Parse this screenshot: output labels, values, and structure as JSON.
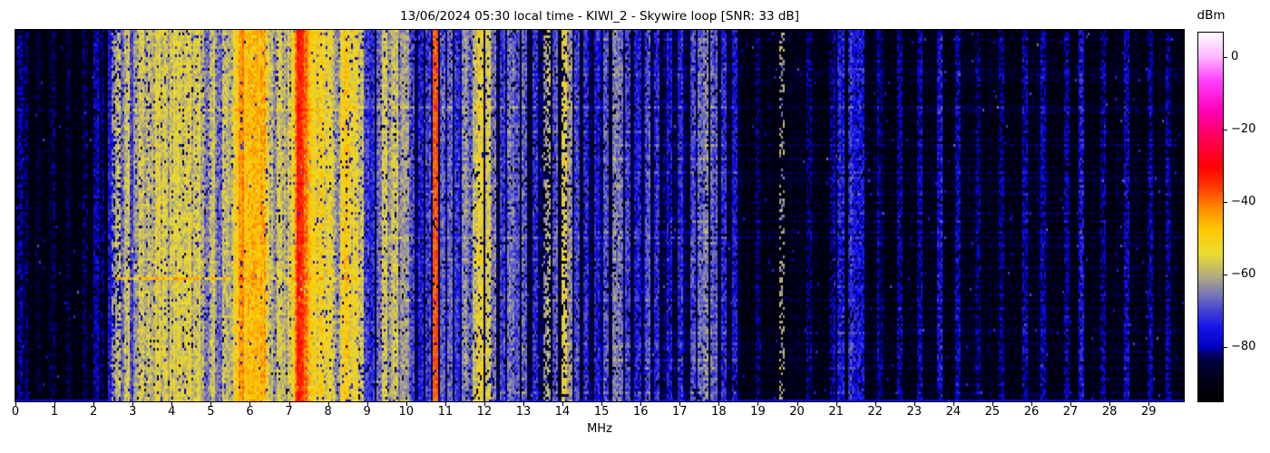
{
  "figure": {
    "title": "13/06/2024 05:30 local time - KIWI_2 - Skywire loop [SNR: 33 dB]",
    "xlabel": "MHz",
    "colorbar_label": "dBm"
  },
  "chart_data": {
    "type": "heatmap",
    "subtype": "radio-spectrogram-waterfall",
    "title": "13/06/2024 05:30 local time - KIWI_2 - Skywire loop [SNR: 33 dB]",
    "xlabel": "MHz",
    "snr_db": 33,
    "x_range_mhz": [
      0,
      29.9
    ],
    "x_ticks": [
      0,
      1,
      2,
      3,
      4,
      5,
      6,
      7,
      8,
      9,
      10,
      11,
      12,
      13,
      14,
      15,
      16,
      17,
      18,
      19,
      20,
      21,
      22,
      23,
      24,
      25,
      26,
      27,
      28,
      29
    ],
    "level_range_dbm": [
      -94.5,
      7
    ],
    "colorbar": {
      "label": "dBm",
      "ticks": [
        {
          "dbm": 0,
          "label": "0"
        },
        {
          "dbm": -20,
          "label": "−20"
        },
        {
          "dbm": -40,
          "label": "−40"
        },
        {
          "dbm": -60,
          "label": "−60"
        },
        {
          "dbm": -80,
          "label": "−80"
        }
      ]
    },
    "colormap_stops": [
      [
        0.0,
        "#000000"
      ],
      [
        0.06,
        "#000018"
      ],
      [
        0.105,
        "#000038"
      ],
      [
        0.125,
        "#000060"
      ],
      [
        0.148,
        "#0000c0"
      ],
      [
        0.2,
        "#1414e8"
      ],
      [
        0.24,
        "#3c3cd8"
      ],
      [
        0.29,
        "#7878b8"
      ],
      [
        0.34,
        "#b4aa7e"
      ],
      [
        0.4,
        "#e8dc32"
      ],
      [
        0.465,
        "#ffc800"
      ],
      [
        0.53,
        "#ff8200"
      ],
      [
        0.58,
        "#ff3c00"
      ],
      [
        0.635,
        "#ff0000"
      ],
      [
        0.71,
        "#ff0050"
      ],
      [
        0.79,
        "#ff00b8"
      ],
      [
        0.87,
        "#ff40ff"
      ],
      [
        0.935,
        "#ffb8ff"
      ],
      [
        1.0,
        "#ffffff"
      ]
    ],
    "regions_format": "from/to in MHz, floor = mean noise floor dBm, streak = vertical striping amplitude dB",
    "regions": [
      {
        "from": 0.0,
        "to": 0.35,
        "floor": -89.0,
        "streak": 2.0
      },
      {
        "from": 0.35,
        "to": 2.35,
        "floor": -90.5,
        "streak": 1.5
      },
      {
        "from": 2.35,
        "to": 3.5,
        "floor": -81.0,
        "streak": 4.0
      },
      {
        "from": 3.5,
        "to": 4.5,
        "floor": -78.0,
        "streak": 5.0
      },
      {
        "from": 4.5,
        "to": 5.55,
        "floor": -80.0,
        "streak": 5.0
      },
      {
        "from": 5.55,
        "to": 6.45,
        "floor": -75.0,
        "streak": 6.0
      },
      {
        "from": 6.45,
        "to": 7.05,
        "floor": -78.0,
        "streak": 5.0
      },
      {
        "from": 7.05,
        "to": 7.65,
        "floor": -68.0,
        "streak": 6.0
      },
      {
        "from": 7.65,
        "to": 8.85,
        "floor": -76.0,
        "streak": 6.0
      },
      {
        "from": 8.85,
        "to": 9.95,
        "floor": -83.0,
        "streak": 4.0
      },
      {
        "from": 9.95,
        "to": 12.3,
        "floor": -84.5,
        "streak": 3.5
      },
      {
        "from": 12.3,
        "to": 18.6,
        "floor": -86.0,
        "streak": 3.0
      },
      {
        "from": 18.6,
        "to": 29.9,
        "floor": -90.0,
        "streak": 1.5
      }
    ],
    "carriers_format": "f = center MHz, l = level dBm, w = width MHz (default 0.05), fl = flicker dB, d = duty cycle 0..1",
    "carriers": [
      {
        "f": 0.08,
        "l": -82
      },
      {
        "f": 0.25,
        "l": -84
      },
      {
        "f": 0.55,
        "l": -86
      },
      {
        "f": 0.95,
        "l": -84
      },
      {
        "f": 1.35,
        "l": -86
      },
      {
        "f": 1.75,
        "l": -84
      },
      {
        "f": 2.05,
        "l": -79
      },
      {
        "f": 2.18,
        "l": -82
      },
      {
        "f": 2.42,
        "l": -74
      },
      {
        "f": 2.5,
        "l": -62,
        "d": 0.6
      },
      {
        "f": 2.62,
        "l": -58,
        "d": 0.75
      },
      {
        "f": 2.72,
        "l": -66
      },
      {
        "f": 2.85,
        "l": -57
      },
      {
        "f": 2.95,
        "l": -70
      },
      {
        "f": 3.07,
        "l": -62
      },
      {
        "f": 3.2,
        "l": -56
      },
      {
        "f": 3.3,
        "l": -60
      },
      {
        "f": 3.42,
        "l": -58
      },
      {
        "f": 3.55,
        "l": -60
      },
      {
        "f": 3.64,
        "l": -55
      },
      {
        "f": 3.73,
        "l": -58
      },
      {
        "f": 3.82,
        "l": -55
      },
      {
        "f": 3.9,
        "l": -60
      },
      {
        "f": 3.98,
        "l": -56
      },
      {
        "f": 4.07,
        "l": -58
      },
      {
        "f": 4.17,
        "l": -55
      },
      {
        "f": 4.28,
        "l": -58
      },
      {
        "f": 4.4,
        "l": -55
      },
      {
        "f": 4.52,
        "l": -62
      },
      {
        "f": 4.62,
        "l": -57
      },
      {
        "f": 4.75,
        "l": -60
      },
      {
        "f": 4.88,
        "l": -64
      },
      {
        "f": 5.0,
        "l": -57
      },
      {
        "f": 5.08,
        "l": -62
      },
      {
        "f": 5.2,
        "l": -66
      },
      {
        "f": 5.32,
        "l": -57
      },
      {
        "f": 5.42,
        "l": -62
      },
      {
        "f": 5.5,
        "l": -60
      },
      {
        "f": 5.6,
        "l": -54
      },
      {
        "f": 5.68,
        "l": -50
      },
      {
        "f": 5.75,
        "l": -42,
        "w": 0.06,
        "fl": 4,
        "d": 0.95
      },
      {
        "f": 5.83,
        "l": -52
      },
      {
        "f": 5.9,
        "l": -47
      },
      {
        "f": 5.97,
        "l": -52
      },
      {
        "f": 6.05,
        "l": -45
      },
      {
        "f": 6.12,
        "l": -50
      },
      {
        "f": 6.18,
        "l": -47
      },
      {
        "f": 6.25,
        "l": -52
      },
      {
        "f": 6.31,
        "l": -44
      },
      {
        "f": 6.4,
        "l": -54
      },
      {
        "f": 6.5,
        "l": -58
      },
      {
        "f": 6.6,
        "l": -64
      },
      {
        "f": 6.72,
        "l": -57
      },
      {
        "f": 6.82,
        "l": -60
      },
      {
        "f": 6.92,
        "l": -62
      },
      {
        "f": 7.0,
        "l": -56
      },
      {
        "f": 7.1,
        "l": -50
      },
      {
        "f": 7.18,
        "l": -42
      },
      {
        "f": 7.27,
        "l": -33,
        "w": 0.1,
        "fl": 4,
        "d": 0.97
      },
      {
        "f": 7.38,
        "l": -40
      },
      {
        "f": 7.45,
        "l": -46
      },
      {
        "f": 7.55,
        "l": -50
      },
      {
        "f": 7.62,
        "l": -53
      },
      {
        "f": 7.72,
        "l": -54
      },
      {
        "f": 7.82,
        "l": -50
      },
      {
        "f": 7.92,
        "l": -57
      },
      {
        "f": 8.02,
        "l": -54
      },
      {
        "f": 8.12,
        "l": -60
      },
      {
        "f": 8.25,
        "l": -62
      },
      {
        "f": 8.35,
        "l": -53
      },
      {
        "f": 8.47,
        "l": -50
      },
      {
        "f": 8.58,
        "l": -54
      },
      {
        "f": 8.7,
        "l": -53
      },
      {
        "f": 8.8,
        "l": -58
      },
      {
        "f": 8.95,
        "l": -68
      },
      {
        "f": 9.1,
        "l": -72
      },
      {
        "f": 9.28,
        "l": -66
      },
      {
        "f": 9.42,
        "l": -57
      },
      {
        "f": 9.55,
        "l": -63
      },
      {
        "f": 9.68,
        "l": -58
      },
      {
        "f": 9.8,
        "l": -66
      },
      {
        "f": 9.9,
        "l": -61
      },
      {
        "f": 10.0,
        "l": -62
      },
      {
        "f": 10.14,
        "l": -70
      },
      {
        "f": 10.35,
        "l": -74
      },
      {
        "f": 10.55,
        "l": -70
      },
      {
        "f": 10.74,
        "l": -38,
        "w": 0.05,
        "fl": 4,
        "d": 0.95
      },
      {
        "f": 10.9,
        "l": -68
      },
      {
        "f": 11.1,
        "l": -66
      },
      {
        "f": 11.28,
        "l": -71
      },
      {
        "f": 11.45,
        "l": -63
      },
      {
        "f": 11.6,
        "l": -67
      },
      {
        "f": 11.76,
        "l": -56
      },
      {
        "f": 11.9,
        "l": -52
      },
      {
        "f": 12.05,
        "l": -56
      },
      {
        "f": 12.2,
        "l": -66
      },
      {
        "f": 12.45,
        "l": -70
      },
      {
        "f": 12.65,
        "l": -66
      },
      {
        "f": 12.82,
        "l": -69
      },
      {
        "f": 13.0,
        "l": -67
      },
      {
        "f": 13.28,
        "l": -72
      },
      {
        "f": 13.58,
        "l": -61,
        "d": 0.55
      },
      {
        "f": 13.78,
        "l": -68
      },
      {
        "f": 14.0,
        "l": -54,
        "d": 0.7
      },
      {
        "f": 14.14,
        "l": -63
      },
      {
        "f": 14.35,
        "l": -71
      },
      {
        "f": 14.6,
        "l": -73
      },
      {
        "f": 14.85,
        "l": -75
      },
      {
        "f": 15.1,
        "l": -68
      },
      {
        "f": 15.3,
        "l": -64
      },
      {
        "f": 15.45,
        "l": -67
      },
      {
        "f": 15.65,
        "l": -71
      },
      {
        "f": 15.9,
        "l": -73
      },
      {
        "f": 16.15,
        "l": -70
      },
      {
        "f": 16.4,
        "l": -74
      },
      {
        "f": 16.7,
        "l": -76
      },
      {
        "f": 17.0,
        "l": -73
      },
      {
        "f": 17.3,
        "l": -70
      },
      {
        "f": 17.5,
        "l": -67
      },
      {
        "f": 17.65,
        "l": -64
      },
      {
        "f": 17.85,
        "l": -69
      },
      {
        "f": 18.1,
        "l": -71
      },
      {
        "f": 18.4,
        "l": -75
      },
      {
        "f": 19.0,
        "l": -84
      },
      {
        "f": 19.6,
        "l": -62,
        "d": 0.3
      },
      {
        "f": 20.3,
        "l": -82
      },
      {
        "f": 20.9,
        "l": -80
      },
      {
        "f": 21.1,
        "l": -76
      },
      {
        "f": 21.35,
        "l": -73
      },
      {
        "f": 21.5,
        "l": -75
      },
      {
        "f": 21.65,
        "l": -77
      },
      {
        "f": 22.1,
        "l": -82
      },
      {
        "f": 22.6,
        "l": -80
      },
      {
        "f": 23.1,
        "l": -81
      },
      {
        "f": 23.62,
        "l": -75
      },
      {
        "f": 24.1,
        "l": -79
      },
      {
        "f": 24.6,
        "l": -83
      },
      {
        "f": 25.2,
        "l": -81
      },
      {
        "f": 25.8,
        "l": -80
      },
      {
        "f": 26.3,
        "l": -79
      },
      {
        "f": 26.9,
        "l": -81
      },
      {
        "f": 27.25,
        "l": -76
      },
      {
        "f": 27.8,
        "l": -81
      },
      {
        "f": 28.4,
        "l": -80
      },
      {
        "f": 29.0,
        "l": -81
      },
      {
        "f": 29.5,
        "l": -82
      }
    ],
    "time_events_format": "row_frac = vertical position 0(top)..1(bottom), boost dB applied from..to MHz",
    "time_events": [
      {
        "row_frac": 0.205,
        "from": 8.5,
        "to": 29.9,
        "boost": 5
      },
      {
        "row_frac": 0.21,
        "from": 0.0,
        "to": 8.5,
        "boost": 3
      },
      {
        "row_frac": 0.13,
        "from": 18.6,
        "to": 29.9,
        "boost": 3
      },
      {
        "row_frac": 0.275,
        "from": 9.0,
        "to": 29.9,
        "boost": 3
      },
      {
        "row_frac": 0.4,
        "from": 18.6,
        "to": 29.9,
        "boost": 3
      },
      {
        "row_frac": 0.56,
        "from": 9.5,
        "to": 29.9,
        "boost": 4
      },
      {
        "row_frac": 0.615,
        "from": 10.0,
        "to": 29.9,
        "boost": 3
      },
      {
        "row_frac": 0.667,
        "from": 2.6,
        "to": 5.55,
        "boost": 11
      },
      {
        "row_frac": 0.667,
        "from": 5.55,
        "to": 9.0,
        "boost": 4
      },
      {
        "row_frac": 0.73,
        "from": 10.0,
        "to": 18.6,
        "boost": 3
      },
      {
        "row_frac": 0.86,
        "from": 12.0,
        "to": 29.9,
        "boost": 3
      }
    ],
    "bottom_row_level_dbm": -77
  }
}
